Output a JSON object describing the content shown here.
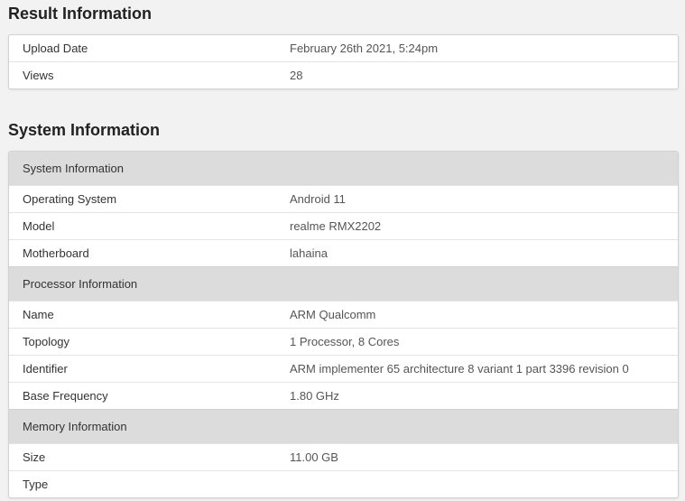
{
  "result_section": {
    "title": "Result Information",
    "rows": [
      {
        "label": "Upload Date",
        "value": "February 26th 2021, 5:24pm"
      },
      {
        "label": "Views",
        "value": "28"
      }
    ]
  },
  "system_section": {
    "title": "System Information",
    "groups": [
      {
        "header": "System Information",
        "rows": [
          {
            "label": "Operating System",
            "value": "Android 11"
          },
          {
            "label": "Model",
            "value": "realme RMX2202"
          },
          {
            "label": "Motherboard",
            "value": "lahaina"
          }
        ]
      },
      {
        "header": "Processor Information",
        "rows": [
          {
            "label": "Name",
            "value": "ARM Qualcomm"
          },
          {
            "label": "Topology",
            "value": "1 Processor, 8 Cores"
          },
          {
            "label": "Identifier",
            "value": "ARM implementer 65 architecture 8 variant 1 part 3396 revision 0"
          },
          {
            "label": "Base Frequency",
            "value": "1.80 GHz"
          }
        ]
      },
      {
        "header": "Memory Information",
        "rows": [
          {
            "label": "Size",
            "value": "11.00 GB"
          },
          {
            "label": "Type",
            "value": ""
          }
        ]
      }
    ]
  },
  "colors": {
    "page_background": "#f2f2f2",
    "card_background": "#ffffff",
    "group_header_background": "#dcdcdc",
    "border": "#d2d2d2"
  }
}
